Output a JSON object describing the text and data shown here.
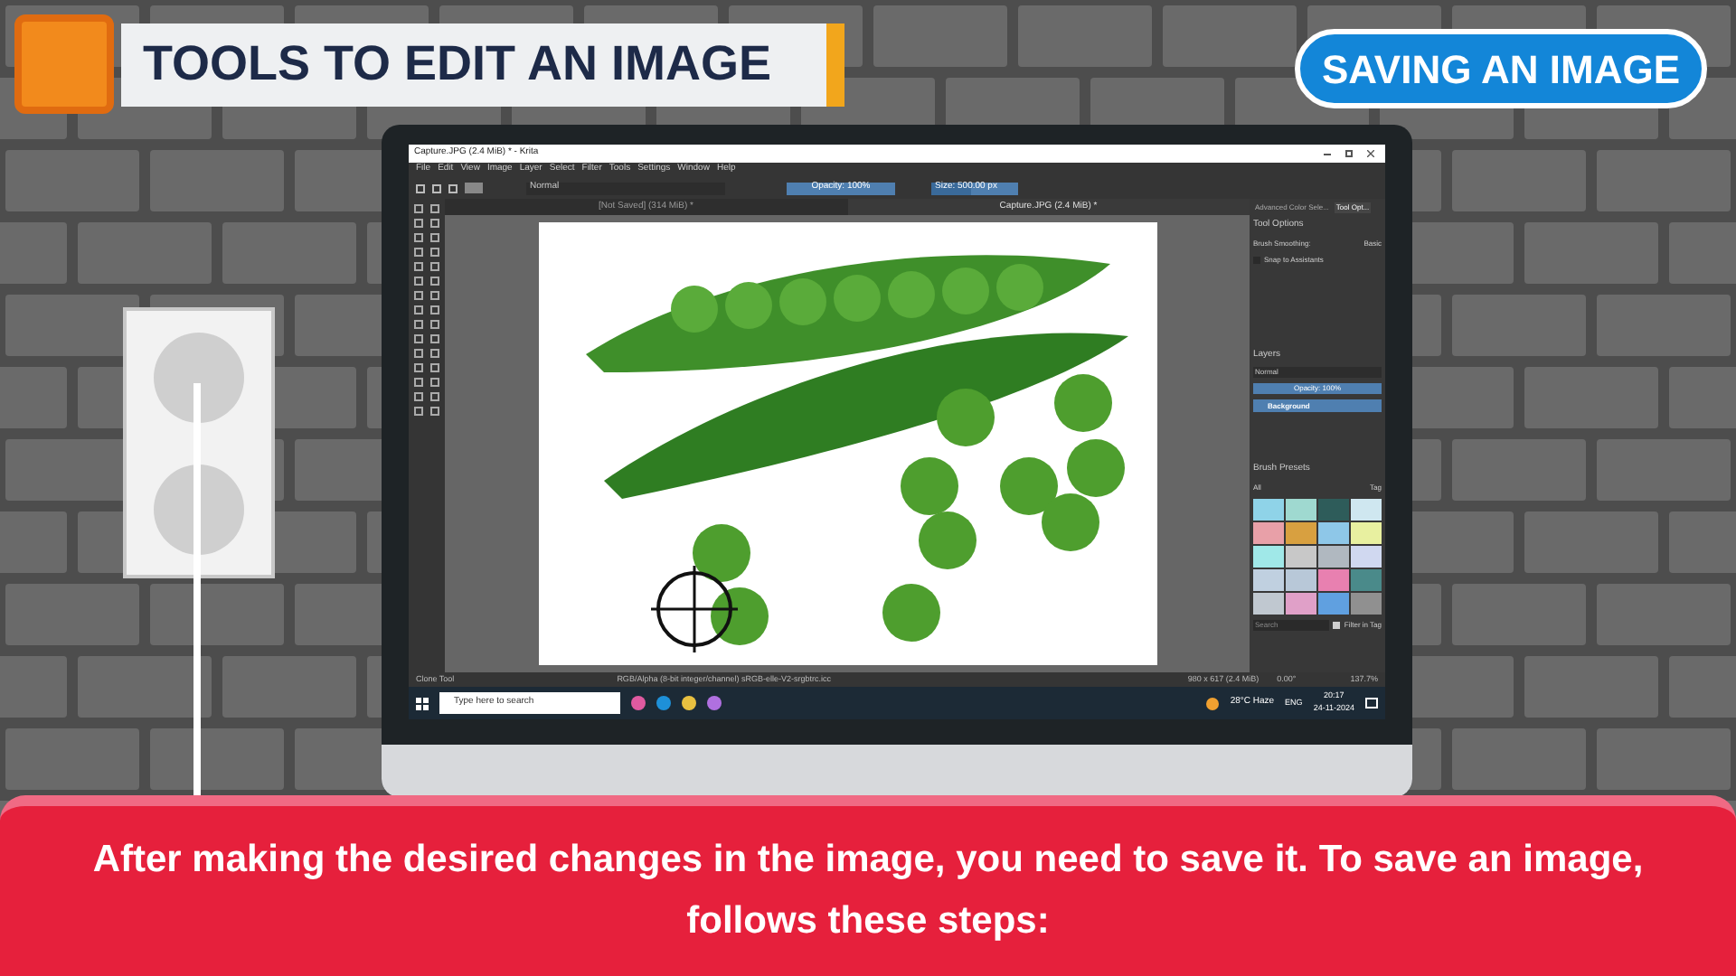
{
  "header": {
    "title": "TOOLS TO EDIT AN IMAGE",
    "badge": "SAVING AN IMAGE"
  },
  "krita": {
    "window_title": "Capture.JPG (2.4 MiB) * - Krita",
    "menu": [
      "File",
      "Edit",
      "View",
      "Image",
      "Layer",
      "Select",
      "Filter",
      "Tools",
      "Settings",
      "Window",
      "Help"
    ],
    "toolbar": {
      "blend_mode": "Normal",
      "opacity": {
        "text": "Opacity: 100%",
        "level": 1
      },
      "size": {
        "text": "Size: 500.00 px",
        "level": 0.45
      }
    },
    "document_tabs": [
      {
        "label": "[Not Saved]  (314 MiB) *",
        "selected": false
      },
      {
        "label": "Capture.JPG (2.4 MiB) *",
        "selected": true
      }
    ],
    "docker_tabs": [
      {
        "label": "Advanced Color Sele...",
        "selected": false
      },
      {
        "label": "Tool Opt...",
        "selected": true
      }
    ],
    "tool_options": {
      "title": "Tool Options",
      "smoothing_label": "Brush Smoothing:",
      "smoothing_value": "Basic",
      "snap_label": "Snap to Assistants",
      "snap_checked": false
    },
    "layers": {
      "title": "Layers",
      "blend_mode": "Normal",
      "opacity": {
        "text": "Opacity: 100%",
        "level": 1
      },
      "items": [
        {
          "name": "Background",
          "selected": true
        }
      ]
    },
    "brush_presets": {
      "title": "Brush Presets",
      "filter": "All",
      "tag": "Tag",
      "search_placeholder": "Search",
      "filter_in_tag": "Filter in Tag",
      "filter_checked": true
    },
    "status_bar": {
      "tool": "Clone Tool",
      "color_space": "RGB/Alpha (8-bit integer/channel)  sRGB-elle-V2-srgbtrc.icc",
      "dimensions": "980 x 617 (2.4 MiB)",
      "rotation": "0.00°",
      "zoom": "137.7%"
    },
    "taskbar": {
      "search_placeholder": "Type here to search",
      "weather": "28°C  Haze",
      "language": "ENG",
      "time": "20:17",
      "date": "24-11-2024"
    }
  },
  "caption": "After making the desired changes in the image, you need to save it. To save an image, follows these steps:"
}
